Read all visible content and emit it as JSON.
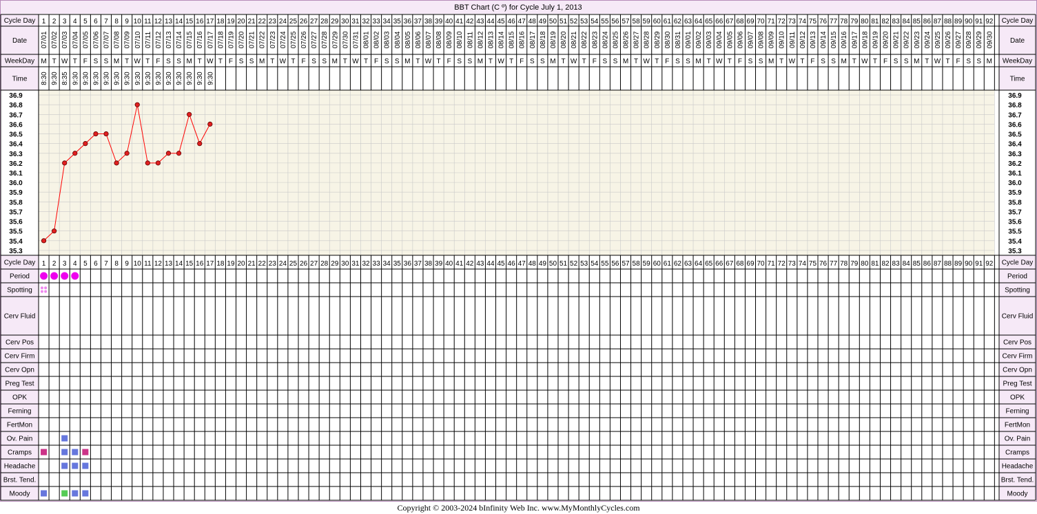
{
  "title": "BBT Chart (C º) for Cycle July 1, 2013",
  "footer": "Copyright © 2003-2024 bInfinity Web Inc.     www.MyMonthlyCycles.com",
  "labels": {
    "cycle_day": "Cycle Day",
    "date": "Date",
    "weekday": "WeekDay",
    "time": "Time"
  },
  "symptom_rows": [
    "Period",
    "Spotting",
    "Cerv Fluid",
    "Cerv Pos",
    "Cerv Firm",
    "Cerv Opn",
    "Preg Test",
    "OPK",
    "Ferning",
    "FertMon",
    "Ov. Pain",
    "Cramps",
    "Headache",
    "Brst. Tend.",
    "Moody"
  ],
  "dates": [
    "07/01",
    "07/02",
    "07/03",
    "07/04",
    "07/05",
    "07/06",
    "07/07",
    "07/08",
    "07/09",
    "07/10",
    "07/11",
    "07/12",
    "07/13",
    "07/14",
    "07/15",
    "07/16",
    "07/17",
    "07/18",
    "07/19",
    "07/20",
    "07/21",
    "07/22",
    "07/23",
    "07/24",
    "07/25",
    "07/26",
    "07/27",
    "07/28",
    "07/29",
    "07/30",
    "07/31",
    "08/01",
    "08/02",
    "08/03",
    "08/04",
    "08/05",
    "08/06",
    "08/07",
    "08/08",
    "08/09",
    "08/10",
    "08/11",
    "08/12",
    "08/13",
    "08/14",
    "08/15",
    "08/16",
    "08/17",
    "08/18",
    "08/19",
    "08/20",
    "08/21",
    "08/22",
    "08/23",
    "08/24",
    "08/25",
    "08/26",
    "08/27",
    "08/28",
    "08/29",
    "08/30",
    "08/31",
    "09/01",
    "09/02",
    "09/03",
    "09/04",
    "09/05",
    "09/06",
    "09/07",
    "09/08",
    "09/09",
    "09/10",
    "09/11",
    "09/12",
    "09/13",
    "09/14",
    "09/15",
    "09/16",
    "09/17",
    "09/18",
    "09/19",
    "09/20",
    "09/21",
    "09/22",
    "09/23",
    "09/24",
    "09/25",
    "09/26",
    "09/27",
    "09/28",
    "09/29",
    "09/30"
  ],
  "weekdays": [
    "M",
    "T",
    "W",
    "T",
    "F",
    "S",
    "S",
    "M",
    "T",
    "W",
    "T",
    "F",
    "S",
    "S",
    "M",
    "T",
    "W",
    "T",
    "F",
    "S",
    "S",
    "M",
    "T",
    "W",
    "T",
    "F",
    "S",
    "S",
    "M",
    "T",
    "W",
    "T",
    "F",
    "S",
    "S",
    "M",
    "T",
    "W",
    "T",
    "F",
    "S",
    "S",
    "M",
    "T",
    "W",
    "T",
    "F",
    "S",
    "S",
    "M",
    "T",
    "W",
    "T",
    "F",
    "S",
    "S",
    "M",
    "T",
    "W",
    "T",
    "F",
    "S",
    "S",
    "M",
    "T",
    "W",
    "T",
    "F",
    "S",
    "S",
    "M",
    "T",
    "W",
    "T",
    "F",
    "S",
    "S",
    "M",
    "T",
    "W",
    "T",
    "F",
    "S",
    "S",
    "M",
    "T",
    "W",
    "T",
    "F",
    "S",
    "S",
    "M"
  ],
  "times": [
    "8:30",
    "9:30",
    "8:35",
    "9:30",
    "9:30",
    "9:30",
    "9:30",
    "9:30",
    "9:30",
    "9:30",
    "9:30",
    "9:30",
    "9:30",
    "9:30",
    "9:30",
    "9:30",
    "9:30"
  ],
  "colors": {
    "grid_bg": "#f7f4e6",
    "grid_line": "#c8c8c8",
    "label_bg": "#f6e9f7",
    "border": "#b58ab8",
    "temp_line": "#ff0000",
    "temp_point": "#e02020",
    "period": "#ee00ee",
    "spotting": "#ee88ee",
    "symptom_blue": "#6677dd",
    "symptom_magenta": "#cc3388",
    "symptom_green": "#55cc55"
  },
  "chart_data": {
    "type": "line",
    "days": 92,
    "ylim": [
      35.3,
      36.9
    ],
    "y_ticks": [
      36.9,
      36.8,
      36.7,
      36.6,
      36.5,
      36.4,
      36.3,
      36.2,
      36.1,
      36.0,
      35.9,
      35.8,
      35.7,
      35.6,
      35.5,
      35.4,
      35.3
    ],
    "temperatures": [
      35.4,
      35.5,
      36.2,
      36.3,
      36.4,
      36.5,
      36.5,
      36.2,
      36.3,
      36.8,
      36.2,
      36.2,
      36.3,
      36.3,
      36.7,
      36.4,
      36.6
    ],
    "period": [
      1,
      2,
      3,
      4
    ],
    "spotting": [
      1
    ],
    "symptoms": {
      "Ov. Pain": [
        {
          "day": 3,
          "color": "blue"
        }
      ],
      "Cramps": [
        {
          "day": 1,
          "color": "magenta"
        },
        {
          "day": 3,
          "color": "blue"
        },
        {
          "day": 4,
          "color": "blue"
        },
        {
          "day": 5,
          "color": "magenta"
        }
      ],
      "Headache": [
        {
          "day": 3,
          "color": "blue"
        },
        {
          "day": 4,
          "color": "blue"
        },
        {
          "day": 5,
          "color": "blue"
        }
      ],
      "Moody": [
        {
          "day": 1,
          "color": "blue"
        },
        {
          "day": 3,
          "color": "green"
        },
        {
          "day": 4,
          "color": "blue"
        },
        {
          "day": 5,
          "color": "blue"
        }
      ]
    }
  }
}
